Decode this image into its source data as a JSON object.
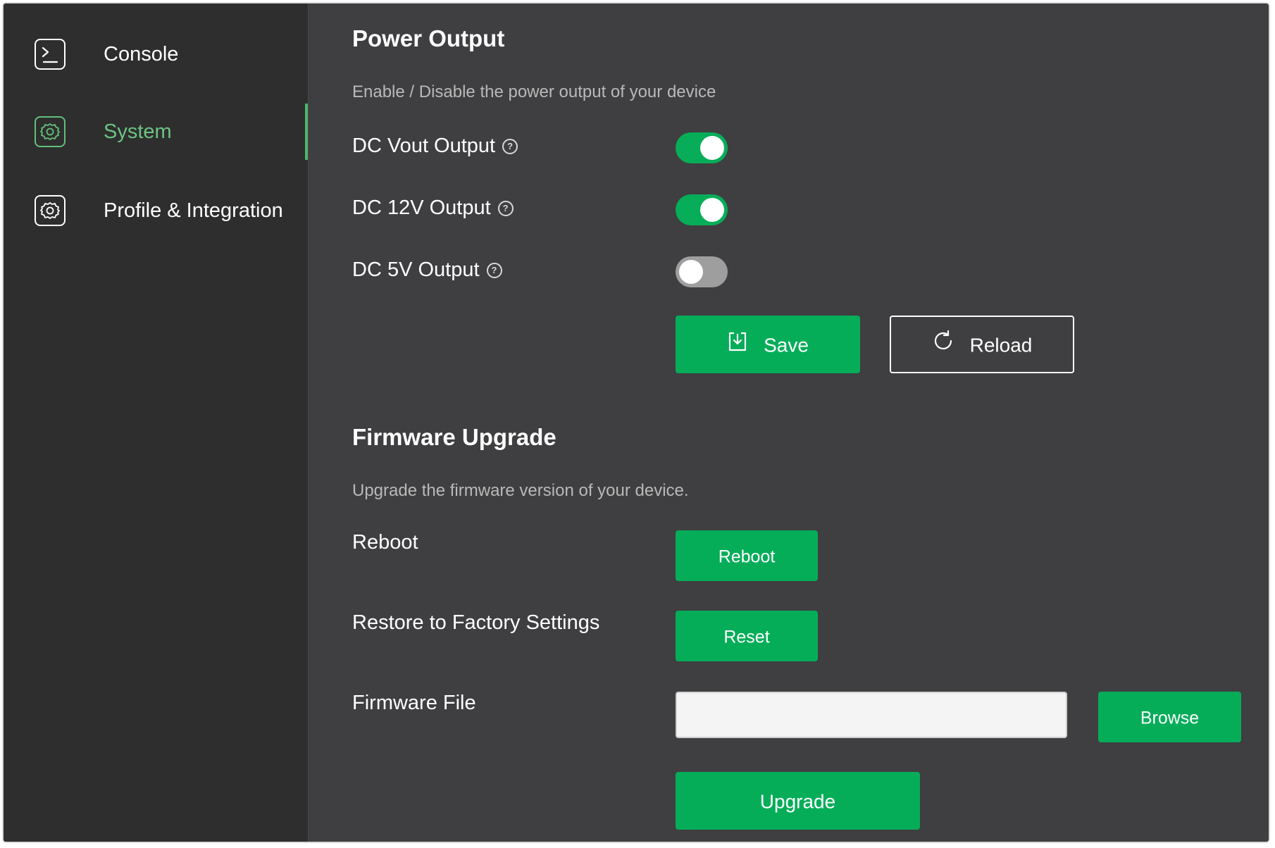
{
  "sidebar": {
    "items": [
      {
        "label": "Console",
        "icon": "terminal-icon"
      },
      {
        "label": "System",
        "icon": "gear-icon",
        "active": true
      },
      {
        "label": "Profile & Integration",
        "icon": "gear-icon"
      }
    ]
  },
  "power_output": {
    "title": "Power Output",
    "description": "Enable / Disable the power output of your device",
    "toggles": [
      {
        "label": "DC Vout Output",
        "enabled": true
      },
      {
        "label": "DC 12V Output",
        "enabled": true
      },
      {
        "label": "DC 5V Output",
        "enabled": false
      }
    ],
    "save_label": "Save",
    "reload_label": "Reload"
  },
  "firmware": {
    "title": "Firmware Upgrade",
    "description": "Upgrade the firmware version of your device.",
    "reboot_label": "Reboot",
    "reboot_button": "Reboot",
    "restore_label": "Restore to Factory Settings",
    "reset_button": "Reset",
    "file_label": "Firmware File",
    "file_value": "",
    "browse_button": "Browse",
    "upgrade_button": "Upgrade"
  },
  "colors": {
    "accent": "#05ad59",
    "active_nav": "#6cc383",
    "background": "#3f3e40",
    "sidebar": "#2e2e2e"
  }
}
